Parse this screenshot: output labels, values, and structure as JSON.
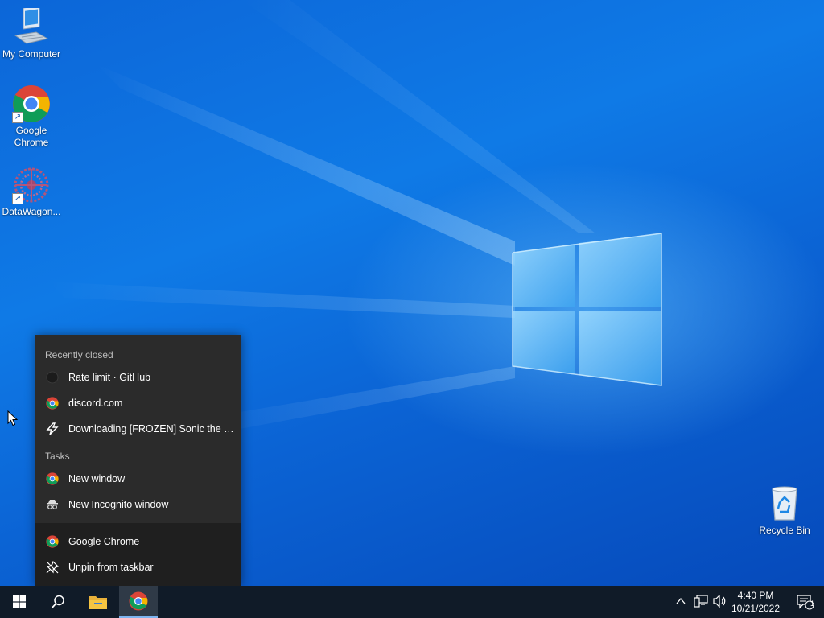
{
  "desktop": {
    "icons": [
      {
        "label": "My Computer",
        "icon": "computer-icon"
      },
      {
        "label": "Google Chrome",
        "icon": "chrome-icon"
      },
      {
        "label": "DataWagon...",
        "icon": "datawagon-icon"
      },
      {
        "label": "Recycle Bin",
        "icon": "recycle-bin-icon"
      }
    ]
  },
  "jumplist": {
    "recent_header": "Recently closed",
    "recent": [
      {
        "label": "Rate limit · GitHub",
        "icon": "github-icon"
      },
      {
        "label": "discord.com",
        "icon": "chrome-icon"
      },
      {
        "label": "Downloading [FROZEN] Sonic the Hed...",
        "icon": "lightning-icon"
      }
    ],
    "tasks_header": "Tasks",
    "tasks": [
      {
        "label": "New window",
        "icon": "chrome-icon"
      },
      {
        "label": "New Incognito window",
        "icon": "incognito-icon"
      }
    ],
    "footer": [
      {
        "label": "Google Chrome",
        "icon": "chrome-icon"
      },
      {
        "label": "Unpin from taskbar",
        "icon": "unpin-icon"
      }
    ]
  },
  "taskbar": {
    "time": "4:40 PM",
    "date": "10/21/2022",
    "notification_count": "1"
  },
  "colors": {
    "jumplist_bg": "#2b2b2b",
    "taskbar_bg": "#101b28",
    "accent": "#7db4f0"
  }
}
